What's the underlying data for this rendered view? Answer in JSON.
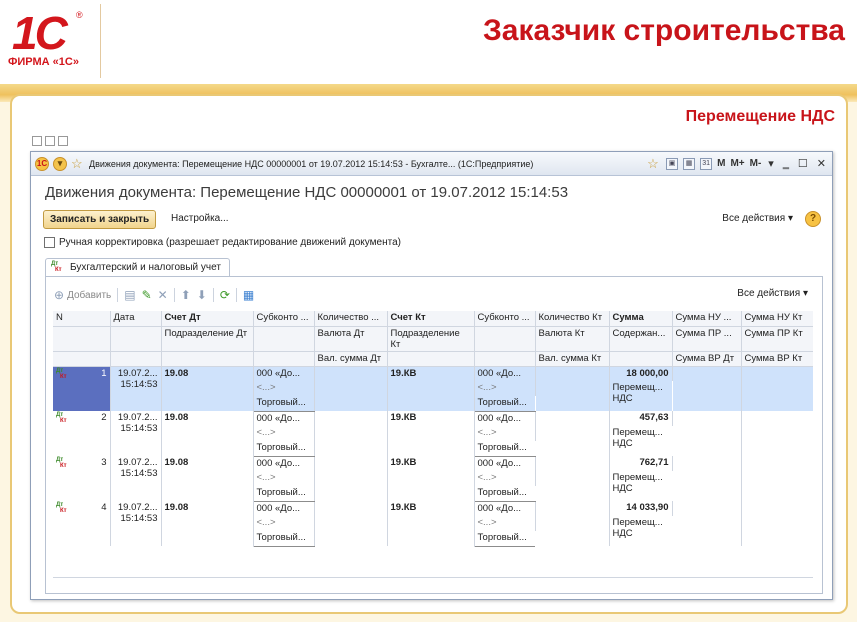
{
  "slide": {
    "logo_mark": "1С",
    "logo_reg": "®",
    "logo_text": "ФИРМА «1С»",
    "title": "Заказчик строительства",
    "subtitle": "Перемещение НДС"
  },
  "window": {
    "titlebar": "Движения документа: Перемещение НДС 00000001 от 19.07.2012 15:14:53 - Бухгалте... (1С:Предприятие)",
    "titlebar_buttons": [
      "M",
      "M+",
      "M-"
    ],
    "title": "Движения документа: Перемещение НДС 00000001 от 19.07.2012 15:14:53",
    "save_close_label": "Записать и закрыть",
    "settings_label": "Настройка...",
    "all_actions_label": "Все действия",
    "help_label": "?",
    "manual_correction_label": "Ручная корректировка (разрешает редактирование движений документа)",
    "manual_correction_checked": false,
    "tab_label": "Бухгалтерский и налоговый учет",
    "grid_add_label": "Добавить",
    "grid_all_actions_label": "Все действия"
  },
  "grid": {
    "header_row1": [
      "N",
      "Дата",
      "Счет Дт",
      "Субконто ...",
      "Количество ...",
      "Счет Кт",
      "Субконто ...",
      "Количество Кт",
      "Сумма",
      "Сумма НУ ...",
      "Сумма НУ Кт"
    ],
    "header_row2": [
      "",
      "",
      "Подразделение Дт",
      "",
      "Валюта Дт",
      "Подразделение Кт",
      "",
      "Валюта Кт",
      "Содержан...",
      "Сумма ПР ...",
      "Сумма ПР Кт"
    ],
    "header_row3": [
      "",
      "",
      "",
      "",
      "Вал. сумма Дт",
      "",
      "",
      "Вал. сумма Кт",
      "",
      "Сумма ВР Дт",
      "Сумма ВР Кт"
    ],
    "rows": [
      {
        "n": "1",
        "date1": "19.07.2...",
        "date2": "15:14:53",
        "acc_dt": "19.08",
        "sub_dt1": "000 «До...",
        "sub_dt2": "<...>",
        "sub_dt3": "Торговый...",
        "acc_kt": "19.КВ",
        "sub_kt1": "000 «До...",
        "sub_kt2": "<...>",
        "sub_kt3": "Торговый...",
        "sum": "18 000,00",
        "content1": "Перемещ...",
        "content2": "НДС"
      },
      {
        "n": "2",
        "date1": "19.07.2...",
        "date2": "15:14:53",
        "acc_dt": "19.08",
        "sub_dt1": "000 «До...",
        "sub_dt2": "<...>",
        "sub_dt3": "Торговый...",
        "acc_kt": "19.КВ",
        "sub_kt1": "000 «До...",
        "sub_kt2": "<...>",
        "sub_kt3": "Торговый...",
        "sum": "457,63",
        "content1": "Перемещ...",
        "content2": "НДС"
      },
      {
        "n": "3",
        "date1": "19.07.2...",
        "date2": "15:14:53",
        "acc_dt": "19.08",
        "sub_dt1": "000 «До...",
        "sub_dt2": "<...>",
        "sub_dt3": "Торговый...",
        "acc_kt": "19.КВ",
        "sub_kt1": "000 «До...",
        "sub_kt2": "<...>",
        "sub_kt3": "Торговый...",
        "sum": "762,71",
        "content1": "Перемещ...",
        "content2": "НДС"
      },
      {
        "n": "4",
        "date1": "19.07.2...",
        "date2": "15:14:53",
        "acc_dt": "19.08",
        "sub_dt1": "000 «До...",
        "sub_dt2": "<...>",
        "sub_dt3": "Торговый...",
        "acc_kt": "19.КВ",
        "sub_kt1": "000 «До...",
        "sub_kt2": "<...>",
        "sub_kt3": "Торговый...",
        "sum": "14 033,90",
        "content1": "Перемещ...",
        "content2": "НДС"
      }
    ],
    "selected_row": 1,
    "row_icon": {
      "dt": "Дт",
      "kt": "Кт"
    }
  },
  "colors": {
    "brand_red": "#c8141a",
    "band_gold": "#efc15e",
    "selection": "#cfe2fb"
  }
}
